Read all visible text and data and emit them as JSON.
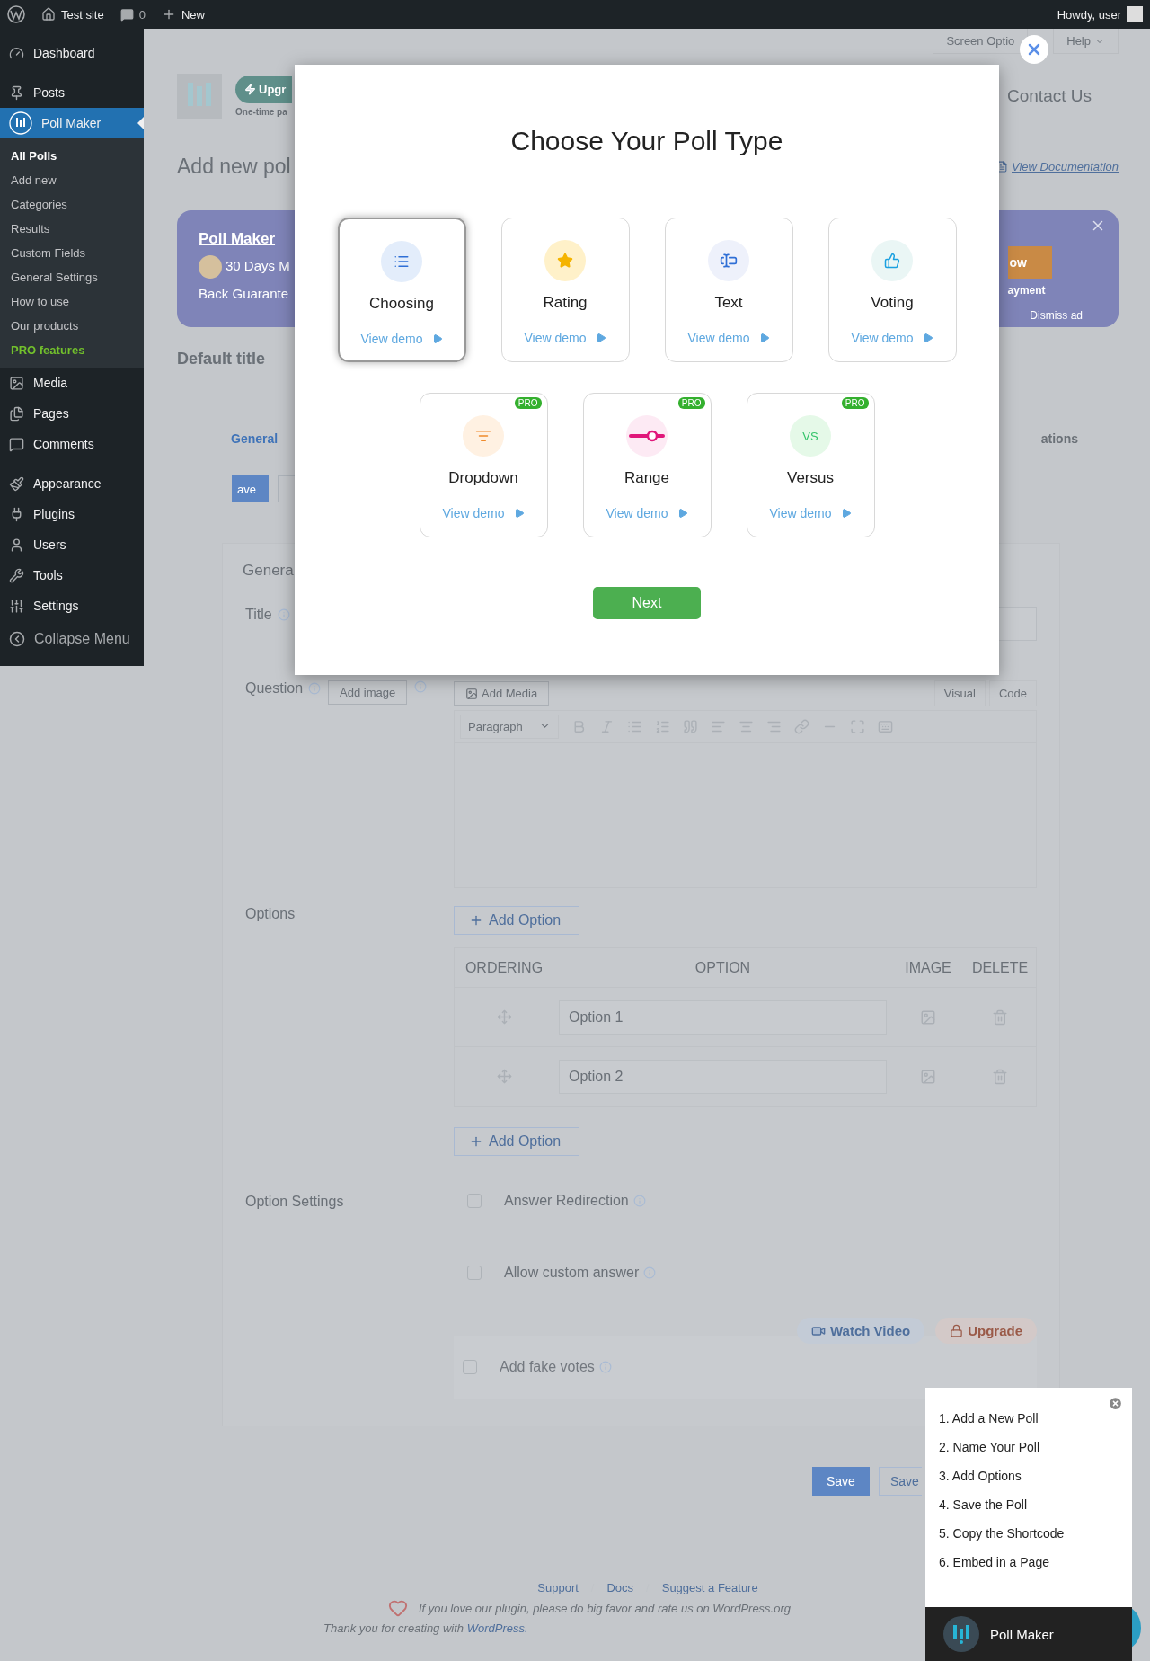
{
  "admin_bar": {
    "site": "Test site",
    "comments": "0",
    "new": "New",
    "greeting": "Howdy, user"
  },
  "sidebar": {
    "items": [
      {
        "label": "Dashboard",
        "selected": false
      },
      {
        "label": "Posts",
        "selected": false
      },
      {
        "label": "Poll Maker",
        "selected": true
      },
      {
        "label": "Media",
        "selected": false
      },
      {
        "label": "Pages",
        "selected": false
      },
      {
        "label": "Comments",
        "selected": false
      },
      {
        "label": "Appearance",
        "selected": false
      },
      {
        "label": "Plugins",
        "selected": false
      },
      {
        "label": "Users",
        "selected": false
      },
      {
        "label": "Tools",
        "selected": false
      },
      {
        "label": "Settings",
        "selected": false
      }
    ],
    "submenu": [
      {
        "label": "All Polls",
        "kind": "link",
        "selected": true
      },
      {
        "label": "Add new",
        "kind": "link",
        "selected": false
      },
      {
        "label": "Categories",
        "kind": "link",
        "selected": false
      },
      {
        "label": "Results",
        "kind": "link",
        "selected": false
      },
      {
        "label": "Custom Fields",
        "kind": "link",
        "selected": false
      },
      {
        "label": "General Settings",
        "kind": "link",
        "selected": false
      },
      {
        "label": "How to use",
        "kind": "link",
        "selected": false
      },
      {
        "label": "Our products",
        "kind": "link",
        "selected": false
      },
      {
        "label": "PRO features",
        "kind": "pro",
        "selected": false
      }
    ],
    "collapse": "Collapse Menu"
  },
  "screen_tabs": [
    "Screen Optio",
    "Help"
  ],
  "header": {
    "upgrade": "Upgr",
    "upgrade_note": "One-time pa",
    "contact": "Contact Us"
  },
  "page_title": "Add new pol",
  "documentation": "View Documentation",
  "banner": {
    "title": "Poll Maker",
    "line_1": "30 Days M",
    "line_2": "Back Guarante",
    "button": "ow",
    "note": "ayment",
    "dismiss": "Dismiss ad"
  },
  "poll_name": "Default title",
  "tabs": [
    {
      "label": "General",
      "selected": true
    },
    {
      "label": "ations",
      "selected": false
    }
  ],
  "save_fragment": "ave",
  "section_title": "Genera",
  "fields": {
    "title_label": "Title",
    "question_label": "Question",
    "add_image": "Add image",
    "add_media": "Add Media",
    "editor_tabs": [
      "Visual",
      "Code"
    ],
    "format": "Paragraph"
  },
  "options": {
    "label": "Options",
    "add": "Add Option",
    "columns": [
      "ORDERING",
      "OPTION",
      "IMAGE",
      "DELETE"
    ],
    "rows": [
      {
        "placeholder": "Option 1"
      },
      {
        "placeholder": "Option 2"
      }
    ],
    "add_bottom": "Add Option"
  },
  "option_settings": {
    "label": "Option Settings",
    "items": [
      {
        "label": "Answer Redirection",
        "checked": false,
        "kind": "free"
      },
      {
        "label": "Allow custom answer",
        "checked": false,
        "kind": "free"
      },
      {
        "label": "Add fake votes",
        "checked": false,
        "kind": "pro"
      }
    ],
    "watch_video": "Watch Video",
    "upgrade": "Upgrade"
  },
  "save_buttons": [
    "Save",
    "Save"
  ],
  "footer": {
    "links": [
      "Support",
      "Docs",
      "Suggest a Feature"
    ],
    "rate": "If you love our plugin, please do big favor and rate us on WordPress.org",
    "thanks": "Thank you for creating with",
    "wp_link": "WordPress."
  },
  "modal": {
    "title": "Choose Your Poll Type",
    "types": [
      {
        "name": "Choosing",
        "kind": "choosing",
        "selected": true,
        "demo": "View demo"
      },
      {
        "name": "Rating",
        "kind": "rating",
        "selected": false,
        "demo": "View demo"
      },
      {
        "name": "Text",
        "kind": "text",
        "selected": false,
        "demo": "View demo"
      },
      {
        "name": "Voting",
        "kind": "voting",
        "selected": false,
        "demo": "View demo"
      },
      {
        "name": "Dropdown",
        "kind": "dropdown",
        "selected": false,
        "demo": "View demo",
        "badge": "PRO"
      },
      {
        "name": "Range",
        "kind": "range",
        "selected": false,
        "demo": "View demo",
        "badge": "PRO"
      },
      {
        "name": "Versus",
        "kind": "versus",
        "selected": false,
        "demo": "View demo",
        "badge": "PRO",
        "icon_text": "VS"
      }
    ],
    "next": "Next"
  },
  "guide": {
    "steps": [
      "1. Add a New Poll",
      "2. Name Your Poll",
      "3. Add Options",
      "4. Save the Poll",
      "5. Copy the Shortcode",
      "6. Embed in a Page"
    ],
    "brand": "Poll Maker"
  }
}
